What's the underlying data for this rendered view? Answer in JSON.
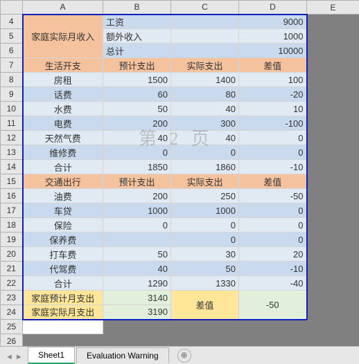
{
  "watermark": "第 2 页",
  "tabs": {
    "active": "Sheet1",
    "second": "Evaluation Warning",
    "add": "⊕"
  },
  "colHeaders": [
    "A",
    "B",
    "C",
    "D",
    "E"
  ],
  "rowHeaders": [
    "4",
    "5",
    "6",
    "7",
    "8",
    "9",
    "10",
    "11",
    "12",
    "13",
    "14",
    "15",
    "16",
    "17",
    "18",
    "19",
    "20",
    "21",
    "22",
    "23",
    "24",
    "25",
    "26"
  ],
  "cells": {
    "A4": "家庭实际月收入",
    "B4": "工资",
    "D4": "9000",
    "B5": "额外收入",
    "D5": "1000",
    "B6": "总计",
    "D6": "10000",
    "A7": "生活开支",
    "B7": "预计支出",
    "C7": "实际支出",
    "D7": "差值",
    "A8": "房租",
    "B8": "1500",
    "C8": "1400",
    "D8": "100",
    "A9": "话费",
    "B9": "60",
    "C9": "80",
    "D9": "-20",
    "A10": "水费",
    "B10": "50",
    "C10": "40",
    "D10": "10",
    "A11": "电费",
    "B11": "200",
    "C11": "300",
    "D11": "-100",
    "A12": "天然气费",
    "B12": "40",
    "C12": "40",
    "D12": "0",
    "A13": "维修费",
    "B13": "0",
    "C13": "0",
    "D13": "0",
    "A14": "合计",
    "B14": "1850",
    "C14": "1860",
    "D14": "-10",
    "A15": "交通出行",
    "B15": "预计支出",
    "C15": "实际支出",
    "D15": "差值",
    "A16": "油费",
    "B16": "200",
    "C16": "250",
    "D16": "-50",
    "A17": "车贷",
    "B17": "1000",
    "C17": "1000",
    "D17": "0",
    "A18": "保险",
    "B18": "0",
    "C18": "0",
    "D18": "0",
    "A19": "保养费",
    "C19": "0",
    "D19": "0",
    "A20": "打车费",
    "B20": "50",
    "C20": "30",
    "D20": "20",
    "A21": "代驾费",
    "B21": "40",
    "C21": "50",
    "D21": "-10",
    "A22": "合计",
    "B22": "1290",
    "C22": "1330",
    "D22": "-40",
    "A23": "家庭预计月支出",
    "B23": "3140",
    "C23": "差值",
    "D23": "-50",
    "A24": "家庭实际月支出",
    "B24": "3190"
  }
}
